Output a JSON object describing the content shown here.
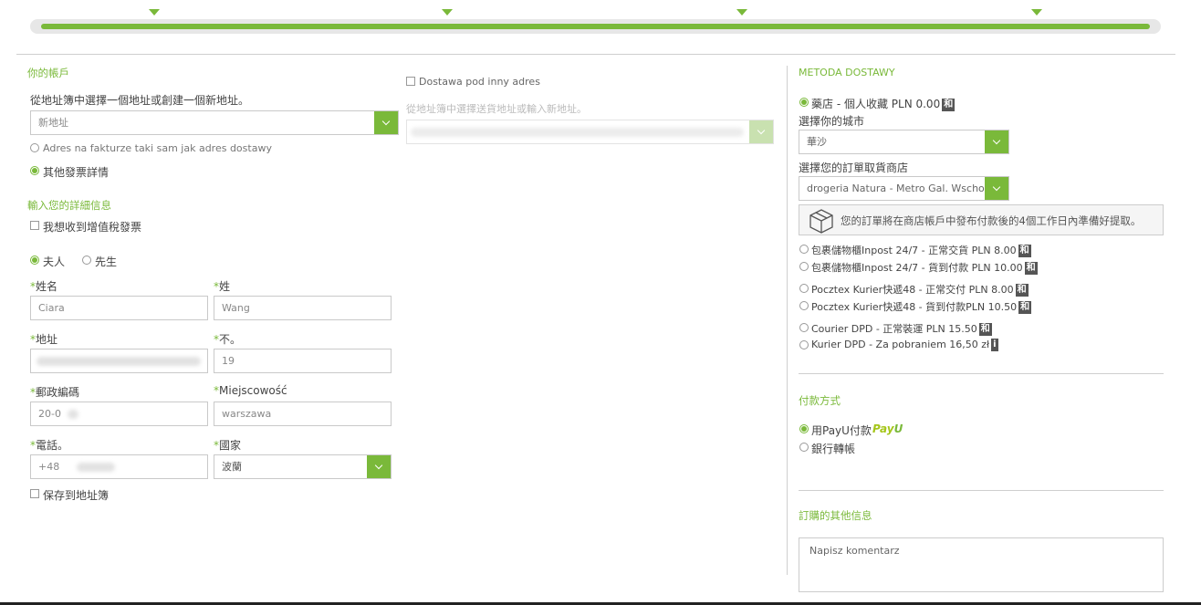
{
  "progress": {
    "steps": [
      {
        "icon": "box-step-icon"
      },
      {
        "icon": "cart-step-icon"
      },
      {
        "icon": "card-step-icon"
      },
      {
        "icon": "check-step-icon"
      }
    ],
    "fill_fraction": 1.0
  },
  "account": {
    "title": "你的帳戶",
    "address_book_label": "從地址簿中選擇一個地址或創建一個新地址。",
    "address_select": "新地址",
    "invoice_same": "Adres na fakturze taki sam jak adres dostawy",
    "invoice_other": "其他發票詳情"
  },
  "details": {
    "title": "輸入您的詳細信息",
    "vat_invoice": "我想收到增值稅發票",
    "salutation_mrs": "夫人",
    "salutation_mr": "先生",
    "first_name_label": "姓名",
    "first_name": "Ciara",
    "last_name_label": "姓",
    "last_name": "Wang",
    "address_label": "地址",
    "number_label": "不。",
    "number": "19",
    "postcode_label": "郵政編碼",
    "postcode": "20-0",
    "city_label": "Miejscowość",
    "city": "warszawa",
    "phone_label": "電話。",
    "phone": "+48",
    "country_label": "國家",
    "country": "波蘭",
    "save_address": "保存到地址簿"
  },
  "delivery_other": {
    "checkbox": "Dostawa pod inny adres",
    "address_book_label": "從地址簿中選擇送貨地址或輸入新地址。"
  },
  "shipping": {
    "title": "METODA DOSTAWY",
    "store_pickup": "藥店 - 個人收藏 PLN 0.00",
    "choose_city_label": "選擇你的城市",
    "city": "華沙",
    "choose_store_label": "選擇您的訂單取貨商店",
    "store": "drogeria Natura - Metro Gal. Wschodni",
    "store_note": "您的訂單將在商店帳戶中發布付款後的4個工作日內準備好提取。",
    "options": [
      {
        "label": "包裹儲物櫃Inpost 24/7 - 正常交貨 PLN 8.00",
        "badge": "和"
      },
      {
        "label": "包裹儲物櫃Inpost 24/7 - 貨到付款 PLN 10.00",
        "badge": "和"
      },
      {
        "label": "Pocztex Kurier快遞48 - 正常交付 PLN 8.00",
        "badge": "和"
      },
      {
        "label": "Pocztex Kurier快遞48 - 貨到付款PLN 10.50",
        "badge": "和"
      },
      {
        "label": "Courier DPD - 正常裝運 PLN 15.50",
        "badge": "和"
      },
      {
        "label": "Kurier DPD - Za pobraniem 16,50 zł",
        "badge": "i"
      }
    ],
    "pickup_badge": "和"
  },
  "payment": {
    "title": "付款方式",
    "payu": "用PayU付款",
    "payu_logo_a": "Pay",
    "payu_logo_b": "U",
    "bank": "銀行轉帳"
  },
  "other_info": {
    "title": "訂購的其他信息",
    "comment_placeholder": "Napisz komentarz"
  },
  "colors": {
    "accent": "#7ab93a",
    "badge": "#555555"
  }
}
